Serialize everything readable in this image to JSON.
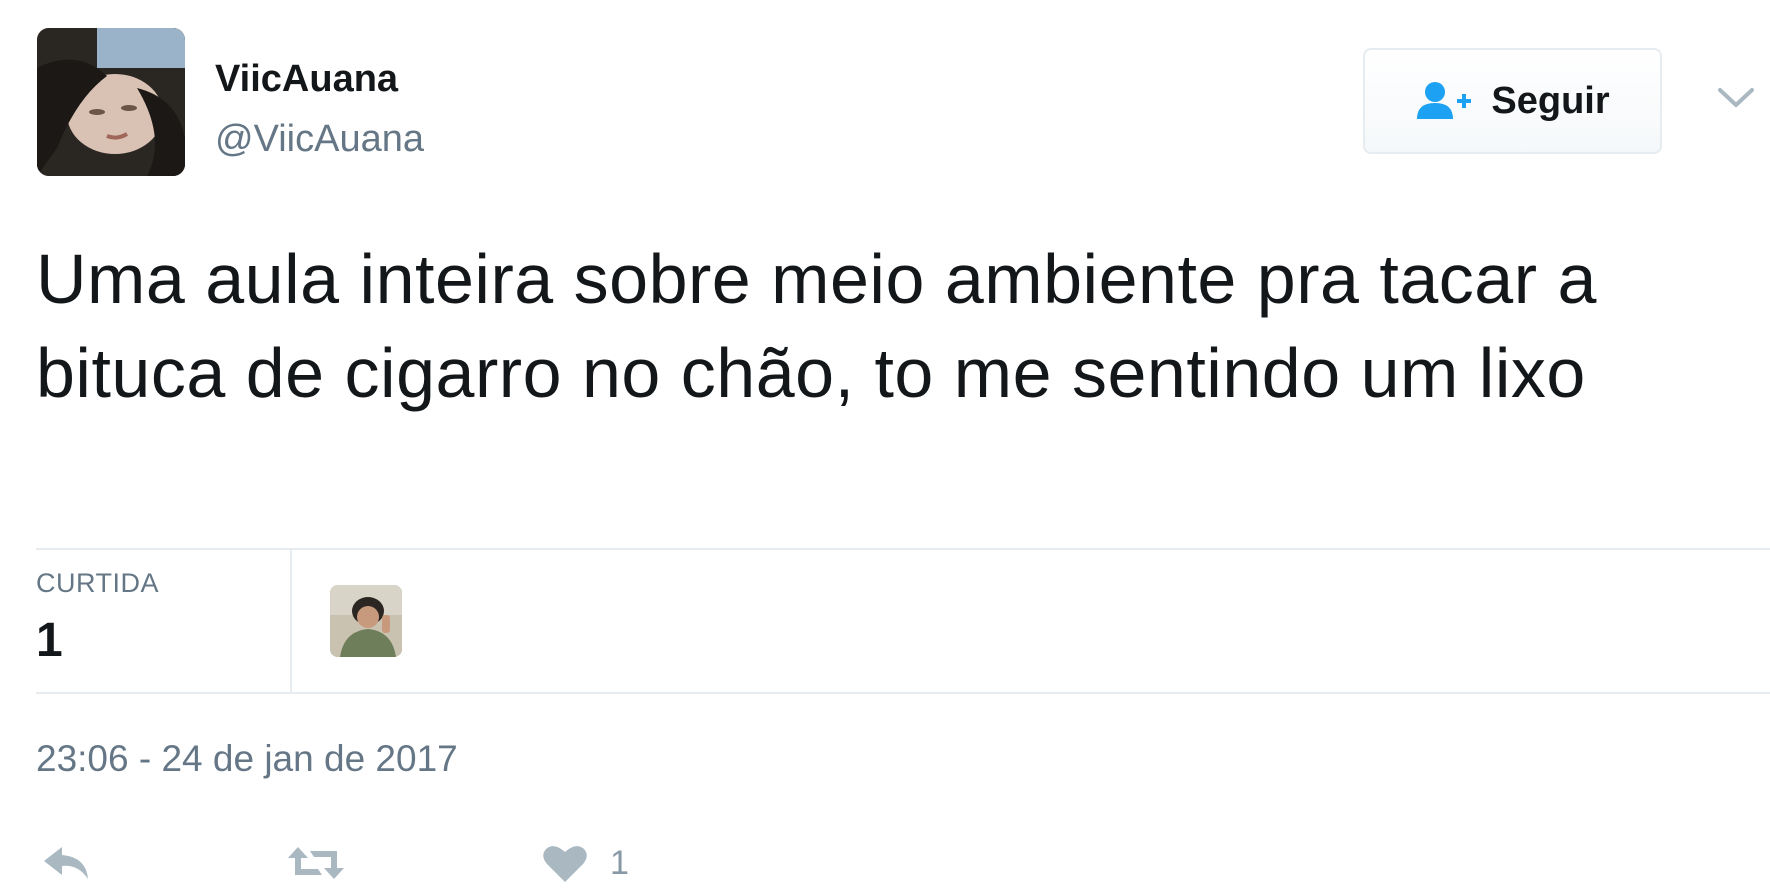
{
  "author": {
    "display_name": "ViicAuana",
    "screen_name": "@ViicAuana",
    "avatar_icon": "profile-photo"
  },
  "follow_button": {
    "label": "Seguir",
    "icon": "person-plus-icon",
    "icon_color": "#1da1f2"
  },
  "menu": {
    "icon": "chevron-down-icon"
  },
  "tweet": {
    "text": "Uma aula inteira sobre meio ambiente pra tacar a bituca de cigarro no chão, to me sentindo um lixo",
    "timestamp": "23:06 - 24 de jan de 2017"
  },
  "stats": {
    "likes_label": "CURTIDA",
    "likes_count": "1",
    "likers": [
      {
        "avatar_icon": "liker-profile-photo"
      }
    ]
  },
  "actions": {
    "reply_icon": "reply-icon",
    "retweet_icon": "retweet-icon",
    "like_icon": "heart-icon",
    "like_count": "1"
  },
  "colors": {
    "text_primary": "#14171a",
    "text_secondary": "#657786",
    "border": "#e6ecf0",
    "action_icon": "#aab8c2",
    "accent": "#1da1f2"
  }
}
